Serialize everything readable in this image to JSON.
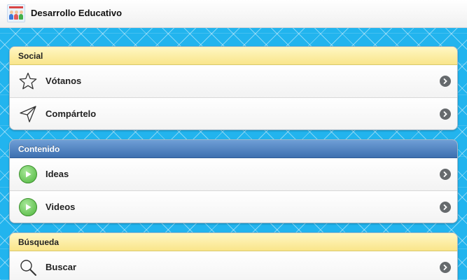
{
  "app": {
    "title": "Desarrollo Educativo",
    "logo_icon": "app-logo-icon"
  },
  "sections": [
    {
      "header": "Social",
      "style": "yellow",
      "items": [
        {
          "label": "Vótanos",
          "icon": "star-icon"
        },
        {
          "label": "Compártelo",
          "icon": "send-icon"
        }
      ]
    },
    {
      "header": "Contenido",
      "style": "blue",
      "items": [
        {
          "label": "Ideas",
          "icon": "play-icon"
        },
        {
          "label": "Videos",
          "icon": "play-icon"
        }
      ]
    },
    {
      "header": "Búsqueda",
      "style": "yellow",
      "items": [
        {
          "label": "Buscar",
          "icon": "search-icon"
        }
      ]
    }
  ],
  "colors": {
    "background": "#22b4ee",
    "header_yellow": "#f9e58a",
    "header_blue": "#3d6fb0",
    "play_green": "#4db53a",
    "chevron": "#666a6d"
  }
}
